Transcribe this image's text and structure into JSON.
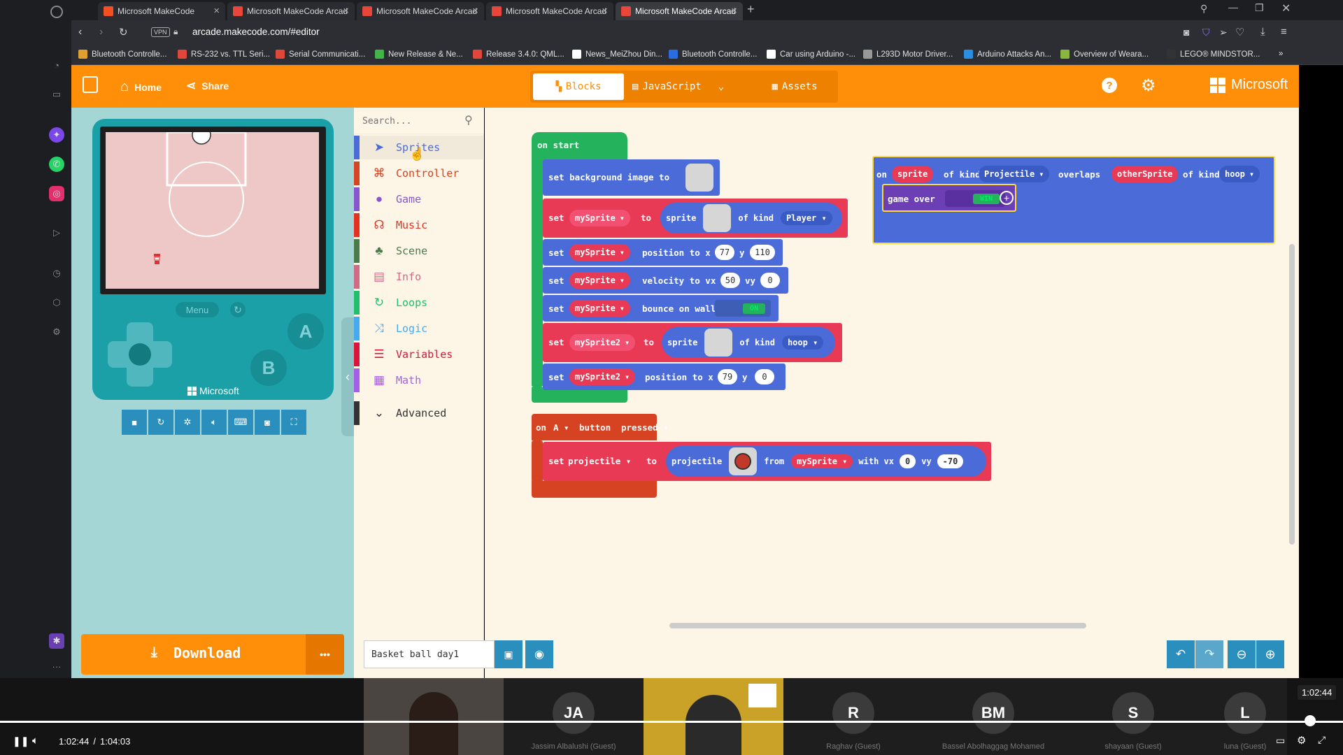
{
  "browser": {
    "tabs": [
      {
        "label": "Microsoft MakeCode"
      },
      {
        "label": "Microsoft MakeCode Arcad"
      },
      {
        "label": "Microsoft MakeCode Arcad"
      },
      {
        "label": "Microsoft MakeCode Arcad"
      },
      {
        "label": "Microsoft MakeCode Arcad"
      }
    ],
    "url": "arcade.makecode.com/#editor",
    "vpn": "VPN",
    "bookmarks": [
      {
        "label": "Bluetooth Controlle...",
        "color": "#e0a030"
      },
      {
        "label": "RS-232 vs. TTL Seri...",
        "color": "#e0463a"
      },
      {
        "label": "Serial Communicati...",
        "color": "#e0463a"
      },
      {
        "label": "New Release & Ne...",
        "color": "#41b549"
      },
      {
        "label": "Release 3.4.0: QML...",
        "color": "#e0463a"
      },
      {
        "label": "News_MeiZhou Din...",
        "color": "#ffffff"
      },
      {
        "label": "Bluetooth Controlle...",
        "color": "#2a6de0"
      },
      {
        "label": "Car using Arduino -...",
        "color": "#ffffff"
      },
      {
        "label": "L293D Motor Driver...",
        "color": "#999999"
      },
      {
        "label": "Arduino Attacks An...",
        "color": "#2a8fe0"
      },
      {
        "label": "Overview of Weara...",
        "color": "#8ab541"
      },
      {
        "label": "LEGO® MINDSTOR...",
        "color": "#333333"
      }
    ]
  },
  "header": {
    "home": "Home",
    "share": "Share",
    "modes": {
      "blocks": "Blocks",
      "javascript": "JavaScript",
      "assets": "Assets"
    },
    "brand": "Microsoft"
  },
  "simulator": {
    "menu": "Menu",
    "btn_a": "A",
    "btn_b": "B",
    "brand": "Microsoft",
    "download": "Download",
    "more": "•••"
  },
  "toolbox": {
    "search_placeholder": "Search...",
    "categories": [
      {
        "label": "Sprites",
        "color": "#4b6cd8",
        "icon": "paper-plane"
      },
      {
        "label": "Controller",
        "color": "#d54322",
        "icon": "gamepad"
      },
      {
        "label": "Game",
        "color": "#8854d0",
        "icon": "circle"
      },
      {
        "label": "Music",
        "color": "#e63022",
        "icon": "headphones"
      },
      {
        "label": "Scene",
        "color": "#4b7b4b",
        "icon": "tree"
      },
      {
        "label": "Info",
        "color": "#cf6a87",
        "icon": "id-card"
      },
      {
        "label": "Loops",
        "color": "#20bf6b",
        "icon": "refresh"
      },
      {
        "label": "Logic",
        "color": "#45aaf2",
        "icon": "shuffle"
      },
      {
        "label": "Variables",
        "color": "#dc143c",
        "icon": "list"
      },
      {
        "label": "Math",
        "color": "#a55eea",
        "icon": "calculator"
      },
      {
        "label": "Advanced",
        "color": "#333333",
        "icon": "chevron-down"
      }
    ]
  },
  "blocks": {
    "on_start": "on start",
    "set_bg": "set background image to",
    "set": "set",
    "to": "to",
    "sprite": "sprite",
    "of_kind": "of kind",
    "position_to_x": "position to x",
    "y": "y",
    "velocity_to_vx": "velocity to vx",
    "vy": "vy",
    "bounce_on_wall": "bounce on wall",
    "on": "ON",
    "mySprite": "mySprite",
    "mySprite2": "mySprite2",
    "Player": "Player",
    "hoop": "hoop",
    "x77": "77",
    "y110": "110",
    "vx50": "50",
    "vy0": "0",
    "x79": "79",
    "y0": "0",
    "on_kw": "on",
    "A": "A",
    "button": "button",
    "pressed": "pressed",
    "projectile_var": "projectile",
    "projectile_fn": "projectile",
    "from": "from",
    "with_vx": "with vx",
    "pvx": "0",
    "pvy": "-70",
    "overlap_on": "on",
    "overlap_sprite": "sprite",
    "overlap_kind1": "of kind",
    "Projectile": "Projectile",
    "overlaps": "overlaps",
    "otherSprite": "otherSprite",
    "overlap_kind2": "of kind",
    "overlap_hoop": "hoop",
    "game_over": "game over",
    "win": "WIN"
  },
  "footer": {
    "project_name": "Basket ball day1"
  },
  "video": {
    "participants": [
      {
        "initials": "JA",
        "name": "Jassim Albalushi (Guest)"
      },
      {
        "initials": "R",
        "name": "Raghav (Guest)"
      },
      {
        "initials": "BM",
        "name": "Bassel Abolhaggag Mohamed"
      },
      {
        "initials": "S",
        "name": "shayaan (Guest)"
      },
      {
        "initials": "L",
        "name": "luna (Guest)"
      }
    ],
    "current_time": "1:02:44",
    "duration": "1:04:03",
    "time_sep": "/",
    "tooltip_time": "1:02:44",
    "progress": 0.979
  }
}
